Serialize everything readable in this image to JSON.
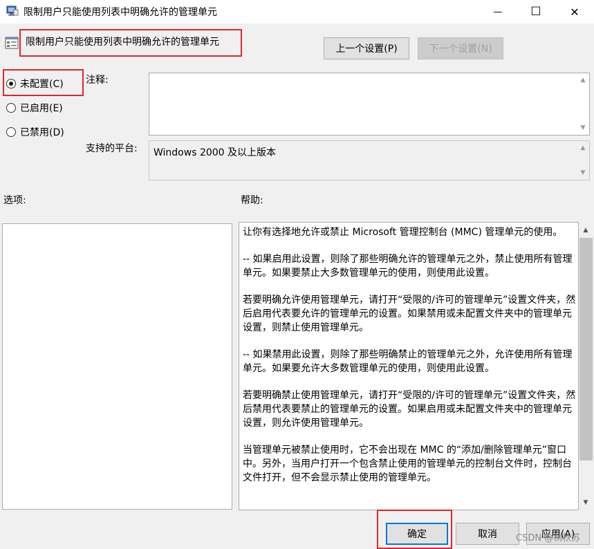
{
  "window": {
    "title": "限制用户只能使用列表中明确允许的管理单元",
    "minimize_glyph": "—",
    "maximize_glyph": "☐",
    "close_glyph": "✕"
  },
  "header": {
    "policy_name": "限制用户只能使用列表中明确允许的管理单元",
    "prev_button": "上一个设置(P)",
    "next_button": "下一个设置(N)"
  },
  "state": {
    "options": [
      {
        "label": "未配置(C)",
        "selected": true
      },
      {
        "label": "已启用(E)",
        "selected": false
      },
      {
        "label": "已禁用(D)",
        "selected": false
      }
    ]
  },
  "comment": {
    "label": "注释:",
    "value": ""
  },
  "platform": {
    "label": "支持的平台:",
    "value": "Windows 2000 及以上版本"
  },
  "options_section": {
    "label": "选项:"
  },
  "help_section": {
    "label": "帮助:",
    "paragraphs": [
      "让你有选择地允许或禁止 Microsoft 管理控制台 (MMC) 管理单元的使用。",
      "-- 如果启用此设置，则除了那些明确允许的管理单元之外，禁止使用所有管理单元。如果要禁止大多数管理单元的使用，则使用此设置。",
      "若要明确允许使用管理单元，请打开“受限的/许可的管理单元”设置文件夹，然后启用代表要允许的管理单元的设置。如果禁用或未配置文件夹中的管理单元设置，则禁止使用管理单元。",
      "-- 如果禁用此设置，则除了那些明确禁止的管理单元之外，允许使用所有管理单元。如果要允许大多数管理单元的使用，则使用此设置。",
      "若要明确禁止使用管理单元，请打开“受限的/许可的管理单元”设置文件夹，然后禁用代表要禁止的管理单元的设置。如果启用或未配置文件夹中的管理单元设置，则允许使用管理单元。",
      "当管理单元被禁止使用时，它不会出现在 MMC 的“添加/删除管理单元”窗口中。另外，当用户打开一个包含禁止使用的管理单元的控制台文件时，控制台文件打开，但不会显示禁止使用的管理单元。"
    ]
  },
  "footer": {
    "ok": "确定",
    "cancel": "取消",
    "apply": "应用(A)"
  },
  "watermark": "CSDN @桐秋苏"
}
